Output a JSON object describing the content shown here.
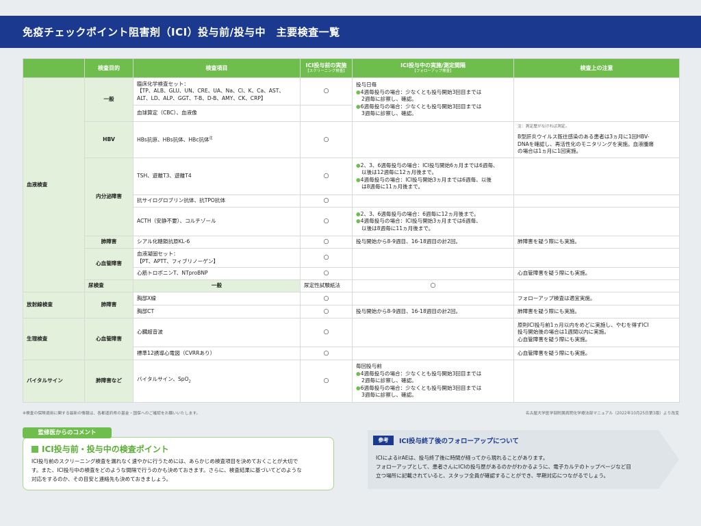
{
  "page_title": "免疫チェックポイント阻害剤（ICI）投与前/投与中　主要検査一覧",
  "table": {
    "headers": {
      "purpose": "検査目的",
      "item": "検査項目",
      "before": "ICI投与前の実施",
      "before_sub": "【スクリーニング検査】",
      "during": "ICI投与中の実施/測定間隔",
      "during_sub": "【フォローアップ検査】",
      "notes": "検査上の注意"
    },
    "circle": "○",
    "bullet": "●",
    "categories": {
      "blood": "血液検査",
      "urine": "尿検査",
      "radiology": "放射線検査",
      "physio": "生理検査",
      "vital": "バイタルサイン"
    },
    "purposes": {
      "general": "一般",
      "hbv": "HBV",
      "endocrine": "内分泌障害",
      "lung": "肺障害",
      "cardio": "心血管障害",
      "urine_general": "一般",
      "rad_lung": "肺障害",
      "phys_cardio": "心血管障害",
      "vital_lung": "肺障害など"
    },
    "items": {
      "biochem_l1": "臨床化学検査セット：",
      "biochem_l2": "【TP、ALB、GLU、UN、CRE、UA、Na、Cl、K、Ca、AST、",
      "biochem_l3": "ALT、LD、ALP、GGT、T-B、D-B、AMY、CK、CRP】",
      "cbc": "血球算定（CBC）、血液像",
      "hbv": "HBs抗原、HBs抗体、HBc抗体",
      "hbv_mark": "注",
      "tsh": "TSH、遊離T3、遊離T4",
      "antitpo": "抗サイログロブリン抗体、抗TPO抗体",
      "acth": "ACTH（安静不要）、コルチゾール",
      "kl6": "シアル化糖鎖抗原KL-6",
      "coag_l1": "血液凝固セット：",
      "coag_l2": "【PT、APTT、フィブリノーゲン】",
      "troponin": "心筋トロポニンT、NTproBNP",
      "urine": "尿定性試験紙法",
      "xray": "胸部X線",
      "ct": "胸部CT",
      "echo": "心臓超音波",
      "ecg": "標準12誘導心電図（CVRRあり）",
      "vital": "バイタルサイン、SpO",
      "vital_sub": "2"
    },
    "during": {
      "general_head": "投与日毎",
      "general_b1_l1": "4週毎投与の場合：少なくとも投与開始3回目までは",
      "general_b1_l2": "2週毎に診察し、確認。",
      "general_b2_l1": "6週毎投与の場合：少なくとも投与開始3回目までは",
      "general_b2_l2": "3週毎に診察し、確認。",
      "tsh_b1_l1": "2、3、6週毎投与の場合：ICI投与開始6ヵ月までは6週毎、",
      "tsh_b1_l2": "以後は12週毎に12ヵ月後まで。",
      "tsh_b2_l1": "4週毎投与の場合：ICI投与開始3ヵ月までは6週毎、以後",
      "tsh_b2_l2": "は8週毎に11ヵ月後まで。",
      "acth_b1_l1": "2、3、6週毎投与の場合：6週毎に12ヵ月後まで。",
      "acth_b2_l1": "4週毎投与の場合：ICI投与開始3ヵ月までは6週毎、",
      "acth_b2_l2": "以後は8週毎に11ヵ月後まで。",
      "kl6": "投与開始から8-9週目、16-18週目の計2回。",
      "ct": "投与開始から8-9週目、16-18週目の計2回。",
      "vital_head": "毎回投与前",
      "vital_b1_l1": "4週毎投与の場合：少なくとも投与開始3回目までは",
      "vital_b1_l2": "2週毎に診察し、確認。",
      "vital_b2_l1": "6週毎投与の場合：少なくとも投与開始3回目までは",
      "vital_b2_l2": "3週毎に診察し、確認。"
    },
    "notes": {
      "hbv_small": "注：測定歴がなければ測定。",
      "hbv_l1": "B型肝炎ウイルス既往感染のある患者は3ヵ月に1回HBV-",
      "hbv_l2": "DNAを確認し、再活性化のモニタリングを実施。血液腫瘍",
      "hbv_l3": "の場合は1ヵ月に1回実施。",
      "kl6": "肺障害を疑う際にも実施。",
      "troponin": "心血管障害を疑う際にも実施。",
      "xray": "フォローアップ検査は適宜実施。",
      "ct": "肺障害を疑う際にも実施。",
      "echo_l1": "原則ICI投与前1ヵ月以内をめどに実施し、やむを得ずICI",
      "echo_l2": "投与開始後の場合は1週間以内に実施。",
      "echo_l3": "心血管障害を疑う際にも実施。",
      "ecg": "心血管障害を疑う際にも実施。"
    }
  },
  "footnote_left": "※検査の保険適用に関する最新の情報は、各都道府県の基金・国保へのご確認をお願いいたします。",
  "footnote_right": "名古屋大学医学部附属病院化学療法部マニュアル（2022年10月25日第3版）より改変",
  "comment": {
    "tag": "監修医からのコメント",
    "title": "ICI投与前・投与中の検査ポイント",
    "l1": "ICI投与前のスクリーニング検査を漏れなく速やかに行うためには、あらかじめ検査項目を決めておくことが大切で",
    "l2": "す。また、ICI投与中の検査をどのような間隔で行うのかも決めておきます。さらに、検査結果に基づいてどのような",
    "l3": "対応をするのか、その目安と連絡先も決めておきましょう。"
  },
  "reference": {
    "tag": "参考",
    "title": "ICI投与終了後のフォローアップについて",
    "l1": "ICIによるirAEは、投与終了後に時間が経ってから現れることがあります。",
    "l2": "フォローアップとして、患者さんにICIの投与歴があるのかがわかるように、電子カルテのトップページなど目",
    "l3": "立つ場所に記載されていると、スタッフ全員が確認することができ、早期対応につながるでしょう。"
  },
  "colors": {
    "navy": "#1b3a8f",
    "green": "#6fbd4c",
    "light_green": "#e3f0dc",
    "ref_bg": "#dfe4e9"
  }
}
